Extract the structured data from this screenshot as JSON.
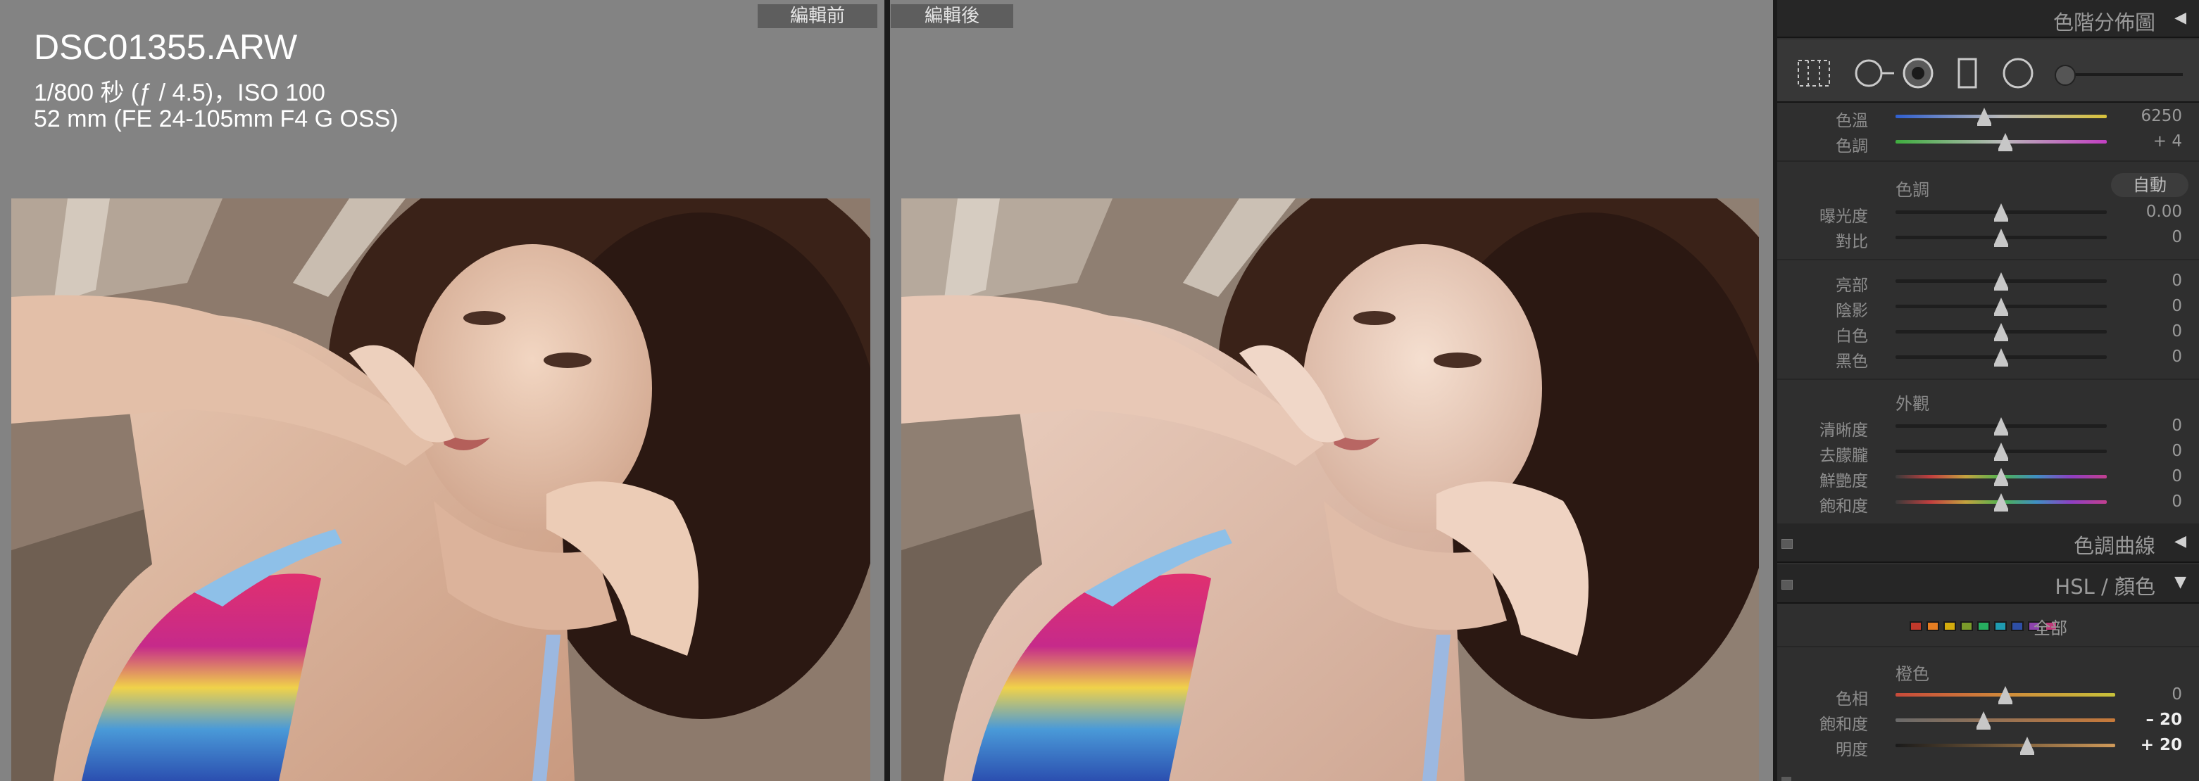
{
  "compare": {
    "before_label": "編輯前",
    "after_label": "編輯後"
  },
  "photo_info": {
    "filename": "DSC01355.ARW",
    "exposure": "1/800 秒 (ƒ / 4.5)，ISO 100",
    "lens": "52 mm (FE 24-105mm F4 G OSS)"
  },
  "panel": {
    "headers": {
      "tone_split": "色階分佈圖",
      "tone_curve": "色調曲線",
      "hsl": "HSL / 顏色"
    },
    "white_balance": [
      {
        "label": "色溫",
        "value": "6250",
        "position": 0.42,
        "track": "temp"
      },
      {
        "label": "色調",
        "value": "+ 4",
        "position": 0.52,
        "track": "tint"
      }
    ],
    "tone": {
      "title": "色調",
      "auto_label": "自動",
      "sliders": [
        {
          "label": "曝光度",
          "value": "0.00",
          "position": 0.5
        },
        {
          "label": "對比",
          "value": "0",
          "position": 0.5
        }
      ],
      "sliders2": [
        {
          "label": "亮部",
          "value": "0",
          "position": 0.5
        },
        {
          "label": "陰影",
          "value": "0",
          "position": 0.5
        },
        {
          "label": "白色",
          "value": "0",
          "position": 0.5
        },
        {
          "label": "黑色",
          "value": "0",
          "position": 0.5
        }
      ]
    },
    "presence": {
      "title": "外觀",
      "sliders": [
        {
          "label": "清晰度",
          "value": "0",
          "position": 0.5,
          "track": "plain"
        },
        {
          "label": "去朦朧",
          "value": "0",
          "position": 0.5,
          "track": "plain"
        },
        {
          "label": "鮮艷度",
          "value": "0",
          "position": 0.5,
          "track": "rainbow"
        },
        {
          "label": "飽和度",
          "value": "0",
          "position": 0.5,
          "track": "rainbow"
        }
      ]
    },
    "hsl": {
      "all_label": "全部",
      "swatch_colors": [
        "#c0392b",
        "#e67e22",
        "#d4ac0d",
        "#7a9a2a",
        "#27ae60",
        "#1f9bb0",
        "#2e4fa5",
        "#8e44ad",
        "#c0397a"
      ],
      "subtitle": "橙色",
      "sliders": [
        {
          "label": "色相",
          "value": "0",
          "position": 0.5,
          "bold": false,
          "track": "hue"
        },
        {
          "label": "飽和度",
          "value": "– 20",
          "position": 0.4,
          "bold": true,
          "track": "sat"
        },
        {
          "label": "明度",
          "value": "+ 20",
          "position": 0.6,
          "bold": true,
          "track": "lum"
        }
      ]
    }
  },
  "colors": {
    "panel_bg": "#2f2f2f",
    "view_bg": "#838383",
    "knob": "#c7c7c7"
  }
}
